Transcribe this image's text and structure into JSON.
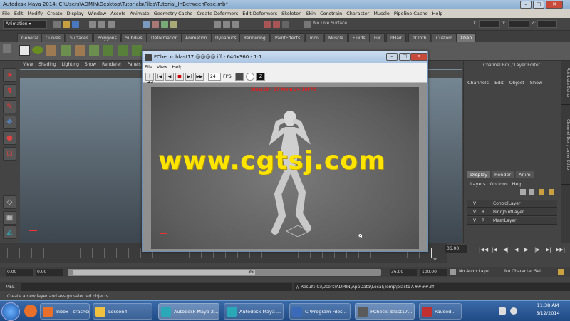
{
  "window": {
    "title": "Autodesk Maya 2014: C:\\Users\\ADMIN\\Desktop\\Tutorials\\Files\\Tutorial_InBetweenPose.mb*"
  },
  "menubar": [
    "File",
    "Edit",
    "Modify",
    "Create",
    "Display",
    "Window",
    "Assets",
    "Animate",
    "Geometry Cache",
    "Create Deformers",
    "Edit Deformers",
    "Skeleton",
    "Skin",
    "Constrain",
    "Character",
    "Muscle",
    "Pipeline Cache",
    "Help"
  ],
  "statusline": {
    "mode": "Animation",
    "live_surface": "No Live Surface",
    "x_label": "X:",
    "y_label": "Y:",
    "z_label": "Z:"
  },
  "shelf_tabs": [
    "General",
    "Curves",
    "Surfaces",
    "Polygons",
    "Subdivs",
    "Deformation",
    "Animation",
    "Dynamics",
    "Rendering",
    "PaintEffects",
    "Toon",
    "Muscle",
    "Fluids",
    "Fur",
    "nHair",
    "nCloth",
    "Custom",
    "XGen"
  ],
  "viewport_menu": [
    "View",
    "Shading",
    "Lighting",
    "Show",
    "Renderer",
    "Panels"
  ],
  "channel_box": {
    "title": "Channel Box / Layer Editor",
    "menu": [
      "Channels",
      "Edit",
      "Object",
      "Show"
    ]
  },
  "vertical_tabs": [
    "Attribute Editor",
    "Channel Box / Layer Editor"
  ],
  "layer_editor": {
    "tabs": [
      "Display",
      "Render",
      "Anim"
    ],
    "menu": [
      "Layers",
      "Options",
      "Help"
    ],
    "layers": [
      {
        "v": "V",
        "r": "",
        "name": "ControlLayer"
      },
      {
        "v": "V",
        "r": "R",
        "name": "BindJointLayer"
      },
      {
        "v": "V",
        "r": "R",
        "name": "MeshLayer"
      }
    ]
  },
  "timeline": {
    "current_frame": "36.00",
    "end_label": "36"
  },
  "range": {
    "start": "0.00",
    "anim_start": "0.00",
    "thumb_value": "36",
    "anim_end": "36.00",
    "end": "100.00",
    "anim_layer": "No Anim Layer",
    "character_set": "No Character Set"
  },
  "command_line": {
    "mel": "MEL",
    "result": "// Result: C:\\Users\\ADMIN\\AppData\\Local\\Temp\\blast17.####.iff"
  },
  "help_line": "Create a new layer and assign selected objects",
  "fcheck": {
    "title": "FCheck: blast17.@@@@.iff - 640x360 - 1:1",
    "menu": [
      "File",
      "View",
      "Help"
    ],
    "fps_value": "24",
    "fps_label": "FPS",
    "red_note": "blast16 - 17 Mem 24.18FPS",
    "frame_number": "9"
  },
  "watermark": "www.cgtsj.com",
  "taskbar": {
    "items": [
      {
        "label": "Inbox - crashcou...",
        "color": "#e8702a"
      },
      {
        "label": "Lesson4",
        "color": "#f0c040"
      },
      {
        "label": "Autodesk Maya 2...",
        "color": "#2aa8b8"
      },
      {
        "label": "Autodesk Maya ...",
        "color": "#2aa8b8"
      },
      {
        "label": "C:\\Program Files...",
        "color": "#3a6ab8"
      },
      {
        "label": "FCheck: blast17...",
        "color": "#5a5a5a"
      },
      {
        "label": "Paused...",
        "color": "#c03030"
      }
    ],
    "time": "11:38 AM",
    "date": "5/12/2014"
  }
}
